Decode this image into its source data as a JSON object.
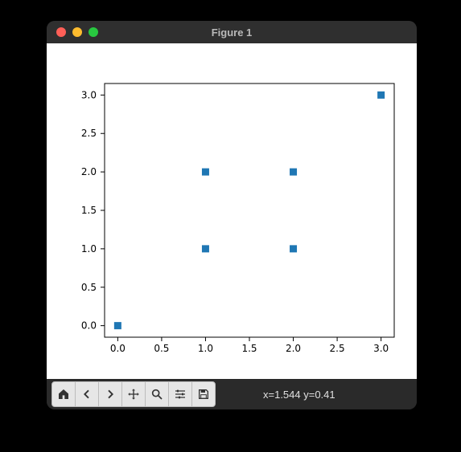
{
  "window": {
    "title": "Figure 1"
  },
  "toolbar": {
    "coords": "x=1.544 y=0.41"
  },
  "chart_data": {
    "type": "scatter",
    "x": [
      0,
      1,
      1,
      2,
      2,
      3
    ],
    "y": [
      0,
      1,
      2,
      1,
      2,
      3
    ],
    "xticks": [
      "0.0",
      "0.5",
      "1.0",
      "1.5",
      "2.0",
      "2.5",
      "3.0"
    ],
    "yticks": [
      "0.0",
      "0.5",
      "1.0",
      "1.5",
      "2.0",
      "2.5",
      "3.0"
    ],
    "xlim": [
      -0.15,
      3.15
    ],
    "ylim": [
      -0.15,
      3.15
    ],
    "marker_color": "#1f77b4",
    "marker": "square"
  }
}
